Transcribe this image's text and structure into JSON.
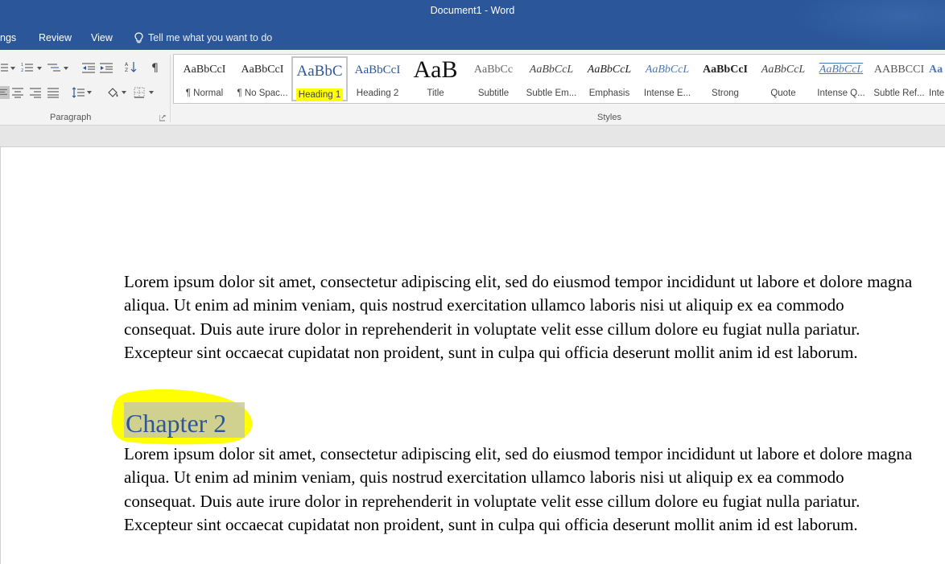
{
  "window": {
    "title": "Document1  -  Word"
  },
  "tabs": [
    {
      "label": "ngs"
    },
    {
      "label": "Review"
    },
    {
      "label": "View"
    }
  ],
  "tell_me": {
    "text": "Tell me what you want to do",
    "icon": "lightbulb-icon"
  },
  "ribbon": {
    "paragraph_group": {
      "label": "Paragraph"
    },
    "styles_group": {
      "label": "Styles"
    }
  },
  "styles": [
    {
      "preview": "AaBbCcI",
      "label": "¶ Normal"
    },
    {
      "preview": "AaBbCcI",
      "label": "¶ No Spac..."
    },
    {
      "preview": "AaBbC",
      "label": "Heading 1",
      "selected": true
    },
    {
      "preview": "AaBbCcI",
      "label": "Heading 2"
    },
    {
      "preview": "AaB",
      "label": "Title"
    },
    {
      "preview": "AaBbCc",
      "label": "Subtitle"
    },
    {
      "preview": "AaBbCcL",
      "label": "Subtle Em..."
    },
    {
      "preview": "AaBbCcL",
      "label": "Emphasis"
    },
    {
      "preview": "AaBbCcL",
      "label": "Intense E..."
    },
    {
      "preview": "AaBbCcI",
      "label": "Strong"
    },
    {
      "preview": "AaBbCcL",
      "label": "Quote"
    },
    {
      "preview": "AaBbCcL",
      "label": "Intense Q..."
    },
    {
      "preview": "AABBCCI",
      "label": "Subtle Ref..."
    },
    {
      "preview": "Aa",
      "label": "Inte"
    }
  ],
  "document": {
    "paragraph1": "Lorem ipsum dolor sit amet, consectetur adipiscing elit, sed do eiusmod tempor incididunt ut labore et dolore magna aliqua. Ut enim ad minim veniam, quis nostrud exercitation ullamco laboris nisi ut aliquip ex ea commodo consequat. Duis aute irure dolor in reprehenderit in voluptate velit esse cillum dolore eu fugiat nulla pariatur. Excepteur sint occaecat cupidatat non proident, sunt in culpa qui officia deserunt mollit anim id est laborum.",
    "heading": "Chapter 2",
    "paragraph2": "Lorem ipsum dolor sit amet, consectetur adipiscing elit, sed do eiusmod tempor incididunt ut labore et dolore magna aliqua. Ut enim ad minim veniam, quis nostrud exercitation ullamco laboris nisi ut aliquip ex ea commodo consequat. Duis aute irure dolor in reprehenderit in voluptate velit esse cillum dolore eu fugiat nulla pariatur. Excepteur sint occaecat cupidatat non proident, sunt in culpa qui officia deserunt mollit anim id est laborum."
  },
  "colors": {
    "titlebar": "#2b579a",
    "heading": "#2e5597",
    "highlight": "#ffff00"
  }
}
